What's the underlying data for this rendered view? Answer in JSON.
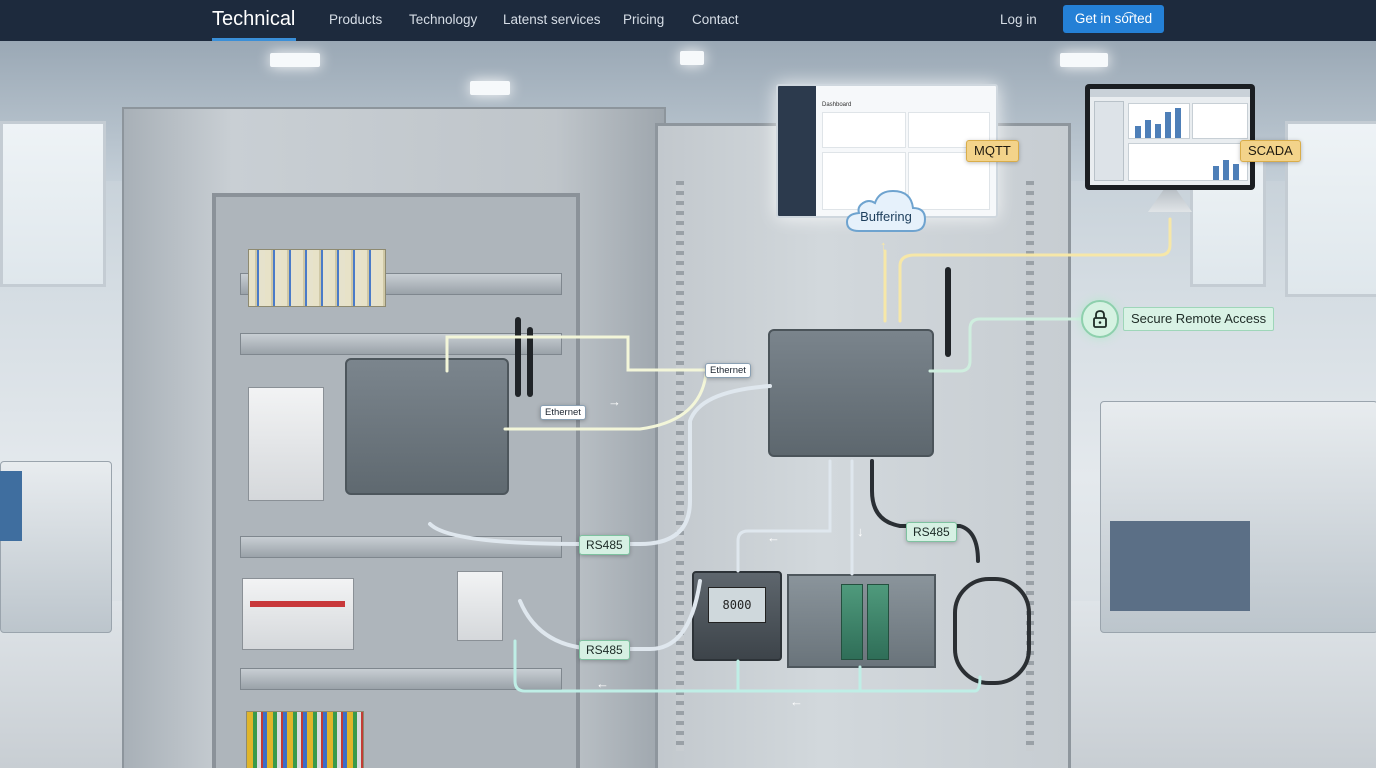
{
  "nav": {
    "brand": "Technical",
    "links": [
      "Products",
      "Technology",
      "Latenst services",
      "Pricing",
      "Contact"
    ],
    "login": "Log in",
    "cta": "Get in so͡rted"
  },
  "diagram": {
    "ethernet_label_1": "Ethernet",
    "ethernet_label_2": "Ethernet",
    "rs485_label_1": "RS485",
    "rs485_label_2": "RS485",
    "rs485_label_3": "RS485",
    "mqtt_label": "MQTT",
    "scada_label": "SCADA",
    "buffering_label": "Buffering",
    "secure_label": "Secure Remote Access",
    "meter_reading": "8000",
    "dashboard_title": "Dashboard"
  },
  "colors": {
    "nav_bg": "#1d2a3d",
    "accent": "#2480d6",
    "connection_line": "#e9f2c6",
    "secure_green": "#d6f0e3",
    "tag_yellow": "#f3d38a"
  }
}
